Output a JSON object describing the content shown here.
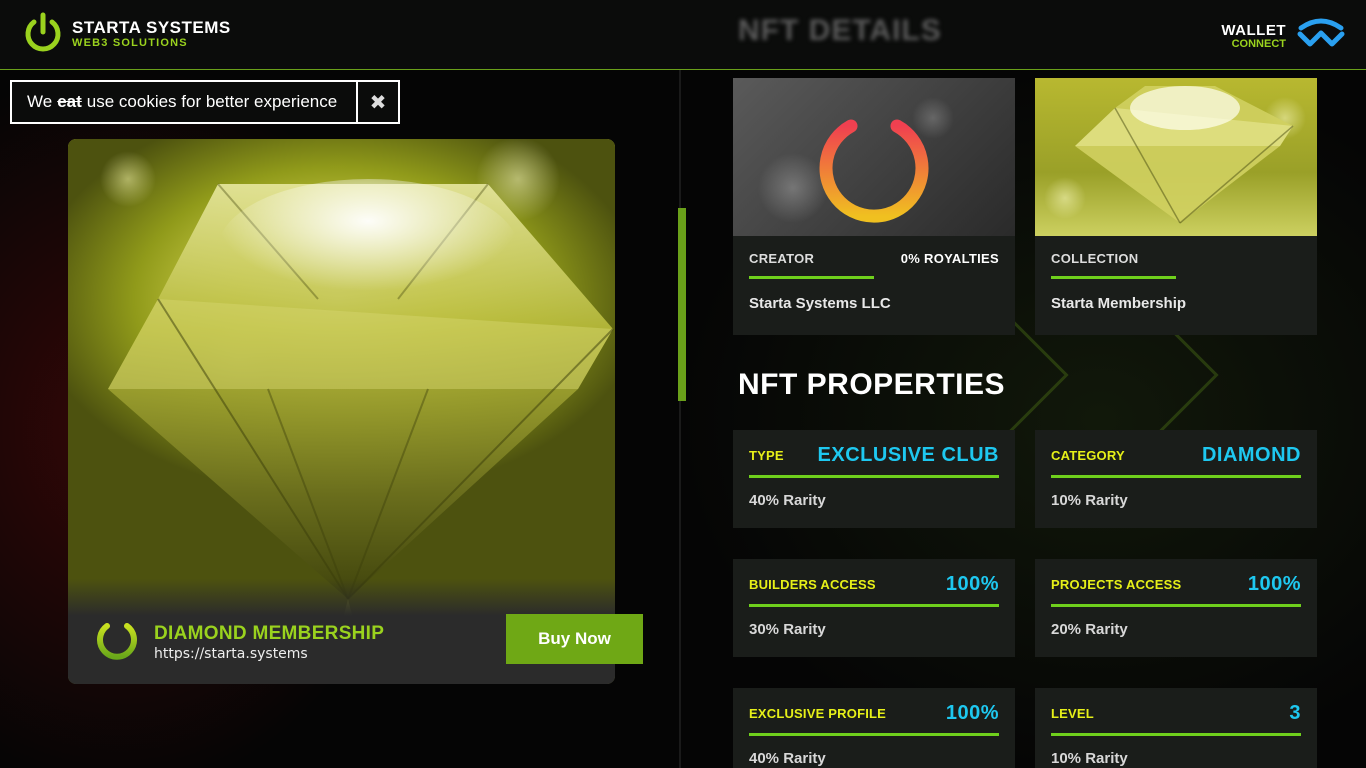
{
  "header": {
    "brand_title": "STARTA SYSTEMS",
    "brand_subtitle": "WEB3 SOLUTIONS",
    "page_title": "NFT DETAILS",
    "wallet_title": "WALLET",
    "wallet_subtitle": "CONNECT",
    "brand_color": "#9ad21e"
  },
  "cookie": {
    "prefix": "We",
    "struck_word": "eat",
    "suffix": "use cookies for better experience",
    "close_symbol": "✖"
  },
  "nft": {
    "name": "DIAMOND MEMBERSHIP",
    "url": "https://starta.systems",
    "buy_label": "Buy Now"
  },
  "details": {
    "creator_label": "CREATOR",
    "royalties": "0% ROYALTIES",
    "creator_value": "Starta Systems LLC",
    "collection_label": "COLLECTION",
    "collection_value": "Starta Membership"
  },
  "properties": {
    "title": "NFT PROPERTIES",
    "items": [
      {
        "key": "TYPE",
        "value": "EXCLUSIVE CLUB",
        "rarity": "40% Rarity"
      },
      {
        "key": "CATEGORY",
        "value": "DIAMOND",
        "rarity": "10% Rarity"
      },
      {
        "key": "BUILDERS ACCESS",
        "value": "100%",
        "rarity": "30% Rarity"
      },
      {
        "key": "PROJECTS ACCESS",
        "value": "100%",
        "rarity": "20% Rarity"
      },
      {
        "key": "EXCLUSIVE PROFILE",
        "value": "100%",
        "rarity": "40% Rarity"
      },
      {
        "key": "LEVEL",
        "value": "3",
        "rarity": "10% Rarity"
      }
    ]
  },
  "colors": {
    "accent_green": "#6fd01c",
    "value_cyan": "#1ec8f0",
    "key_yellow": "#e6f018"
  }
}
